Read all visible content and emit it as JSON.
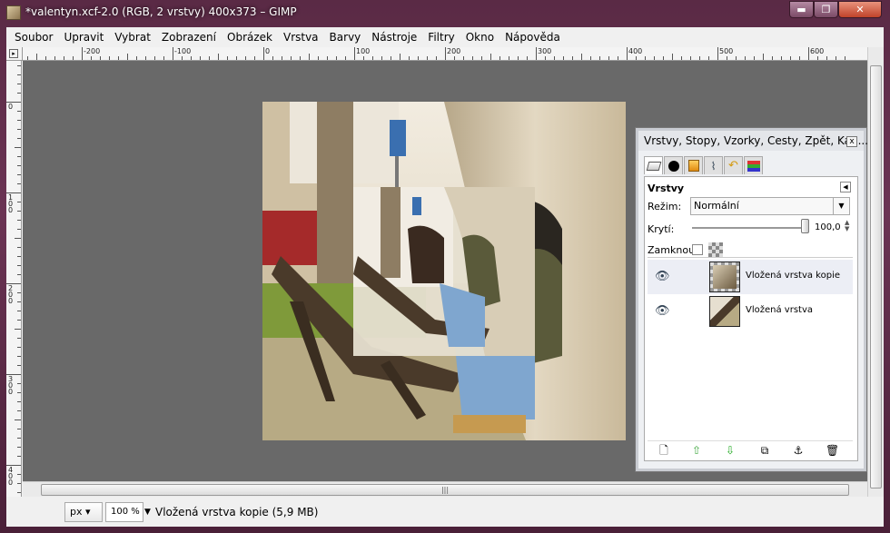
{
  "window": {
    "title": "*valentyn.xcf-2.0 (RGB, 2 vrstvy) 400x373 – GIMP",
    "minimize_label": "▬",
    "maximize_label": "❐",
    "close_label": "✕"
  },
  "menu": {
    "items": [
      "Soubor",
      "Upravit",
      "Vybrat",
      "Zobrazení",
      "Obrázek",
      "Vrstva",
      "Barvy",
      "Nástroje",
      "Filtry",
      "Okno",
      "Nápověda"
    ]
  },
  "rulers": {
    "horizontal_labels": [
      "-200",
      "-100",
      "0",
      "100",
      "200",
      "300",
      "400",
      "500",
      "600"
    ],
    "vertical_labels": [
      "0",
      "100",
      "200",
      "300",
      "400"
    ]
  },
  "layers_dialog": {
    "title": "Vrstvy, Stopy, Vzorky, Cesty, Zpět, Kan...",
    "close_label": "x",
    "panel_title": "Vrstvy",
    "mode_label": "Režim:",
    "mode_value": "Normální",
    "opacity_label": "Krytí:",
    "opacity_value": "100,0",
    "opacity_level": 1.0,
    "lock_label": "Zamknout:",
    "lock_checked": false,
    "tabs": [
      "layers-icon",
      "channels-icon",
      "gradient-icon",
      "paths-icon",
      "undo-icon",
      "palette-icon"
    ],
    "layers": [
      {
        "name": "Vložená vrstva kopie",
        "visible": true,
        "selected": true
      },
      {
        "name": "Vložená vrstva",
        "visible": true,
        "selected": false
      }
    ],
    "buttons": [
      "new-layer-icon",
      "raise-layer-icon",
      "lower-layer-icon",
      "duplicate-layer-icon",
      "anchor-layer-icon",
      "delete-layer-icon"
    ]
  },
  "status": {
    "unit": "px",
    "zoom": "100 %",
    "text": "Vložená vrstva kopie (5,9 MB)"
  },
  "colors": {
    "canvas_bg": "#696969",
    "titlebar": "#5a2a45",
    "close_button": "#c0432a"
  }
}
